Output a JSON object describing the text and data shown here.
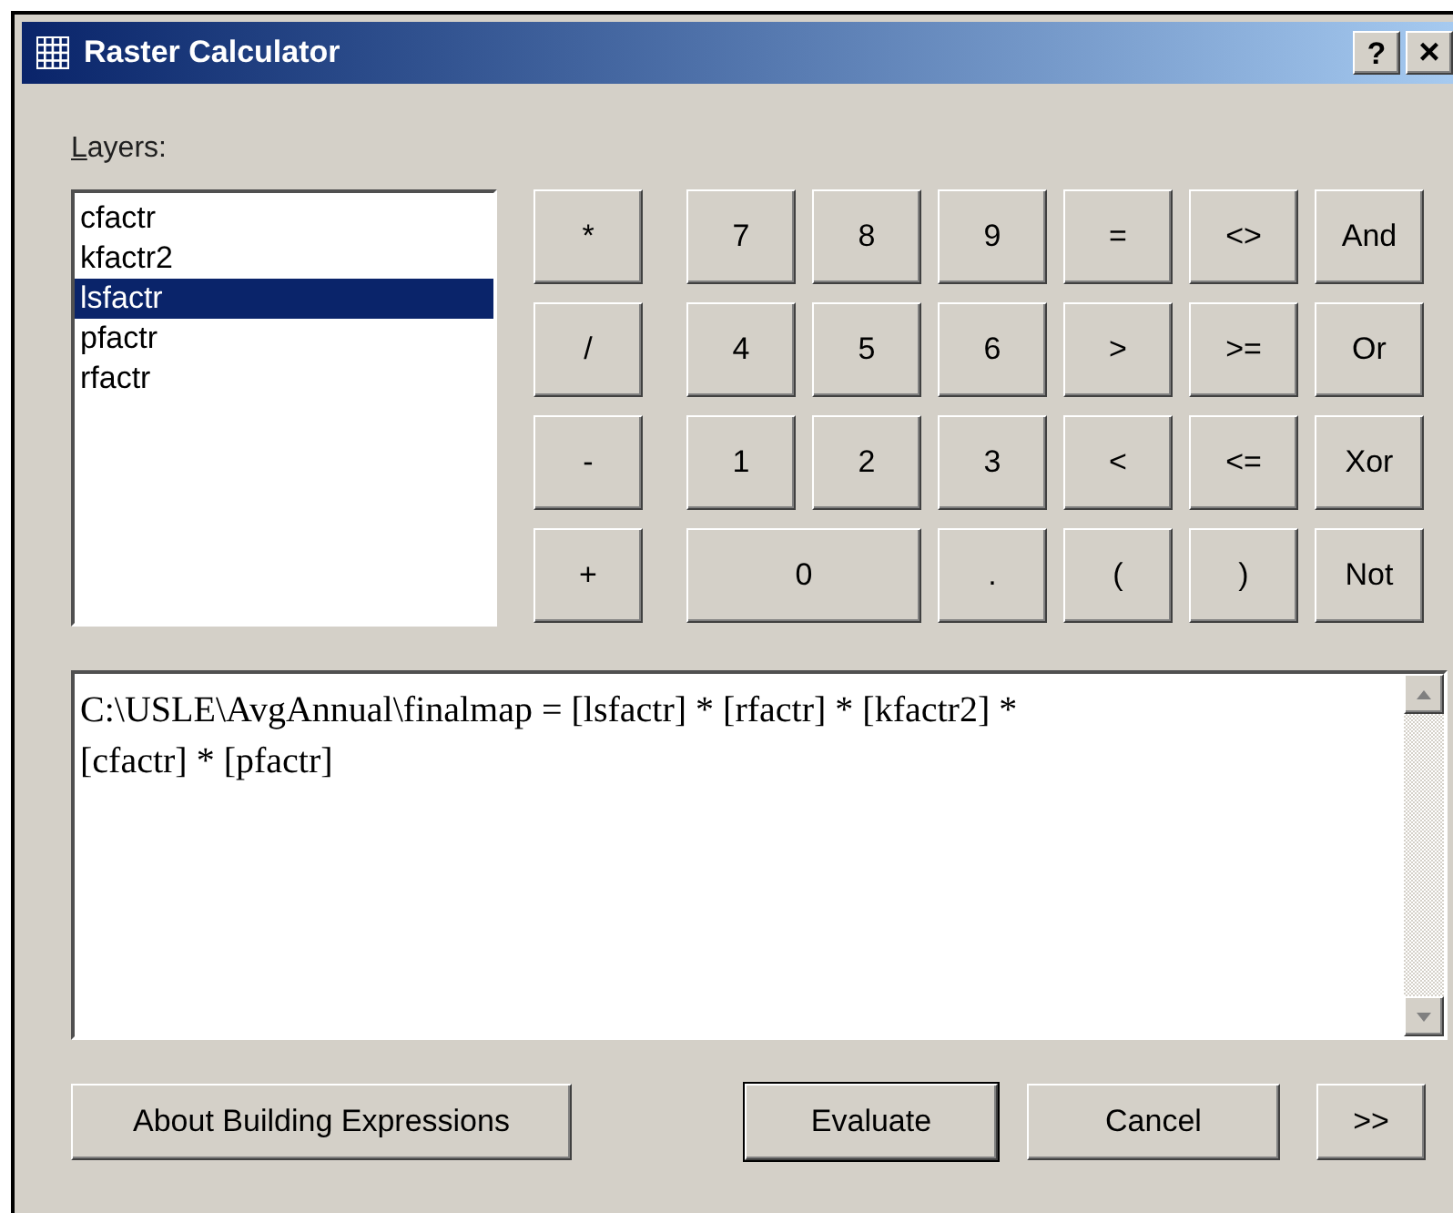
{
  "window": {
    "title": "Raster Calculator",
    "help_button": "?",
    "close_button": "×"
  },
  "layers": {
    "label": "Layers:",
    "items": [
      {
        "name": "cfactr",
        "selected": false
      },
      {
        "name": "kfactr2",
        "selected": false
      },
      {
        "name": "lsfactr",
        "selected": true
      },
      {
        "name": "pfactr",
        "selected": false
      },
      {
        "name": "rfactr",
        "selected": false
      }
    ]
  },
  "keypad": {
    "arithmetic": [
      "*",
      "/",
      "-",
      "+"
    ],
    "digits": [
      {
        "label": "7",
        "wide": false
      },
      {
        "label": "8",
        "wide": false
      },
      {
        "label": "9",
        "wide": false
      },
      {
        "label": "4",
        "wide": false
      },
      {
        "label": "5",
        "wide": false
      },
      {
        "label": "6",
        "wide": false
      },
      {
        "label": "1",
        "wide": false
      },
      {
        "label": "2",
        "wide": false
      },
      {
        "label": "3",
        "wide": false
      },
      {
        "label": "0",
        "wide": true
      },
      {
        "label": ".",
        "wide": false
      }
    ],
    "logic": [
      "=",
      "<>",
      "And",
      ">",
      ">=",
      "Or",
      "<",
      "<=",
      "Xor",
      "(",
      ")",
      "Not"
    ]
  },
  "expression": {
    "lines": [
      "C:\\USLE\\AvgAnnual\\finalmap = [lsfactr] * [rfactr] * [kfactr2] *",
      "[cfactr] * [pfactr]"
    ]
  },
  "buttons": [
    {
      "label": "About Building Expressions",
      "default": false
    },
    {
      "label": "Evaluate",
      "default": true
    },
    {
      "label": "Cancel",
      "default": false
    },
    {
      "label": ">>",
      "default": false
    }
  ]
}
